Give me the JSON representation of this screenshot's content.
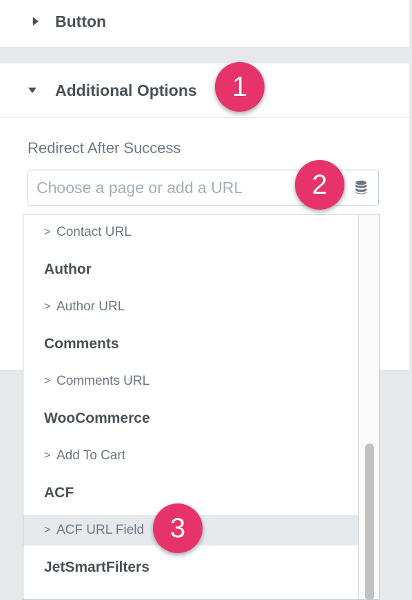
{
  "sections": {
    "button": {
      "title": "Button",
      "expanded": false
    },
    "additional_options": {
      "title": "Additional Options",
      "expanded": true
    }
  },
  "redirect": {
    "label": "Redirect After Success",
    "value": "",
    "placeholder": "Choose a page or add a URL",
    "dynamic_icon": "database-icon"
  },
  "dropdown": {
    "items": [
      {
        "kind": "option",
        "label": "Contact URL"
      },
      {
        "kind": "group",
        "label": "Author"
      },
      {
        "kind": "option",
        "label": "Author URL"
      },
      {
        "kind": "group",
        "label": "Comments"
      },
      {
        "kind": "option",
        "label": "Comments URL"
      },
      {
        "kind": "group",
        "label": "WooCommerce"
      },
      {
        "kind": "option",
        "label": "Add To Cart"
      },
      {
        "kind": "group",
        "label": "ACF"
      },
      {
        "kind": "option",
        "label": "ACF URL Field",
        "highlighted": true
      },
      {
        "kind": "group",
        "label": "JetSmartFilters"
      }
    ],
    "chevron": ">"
  },
  "badges": [
    "1",
    "2",
    "3"
  ],
  "colors": {
    "badge": "#e6336b",
    "highlight_row": "#e6e9ec",
    "page_bg": "#e6e8ea"
  }
}
